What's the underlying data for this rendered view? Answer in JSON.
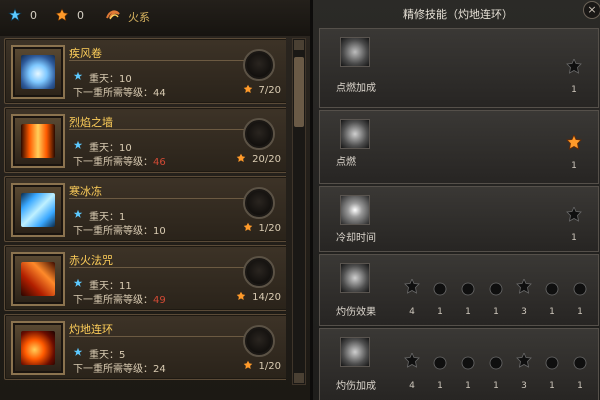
{
  "header": {
    "star_count": "0",
    "gem_count": "0",
    "fire_tab_label": "火系"
  },
  "skills": [
    {
      "name": "疾风卷",
      "level_label": "重天：10",
      "req_label": "下一重所需等级：",
      "req_value": "44",
      "req_red": false,
      "count": "7/20"
    },
    {
      "name": "烈焰之墙",
      "level_label": "重天：10",
      "req_label": "下一重所需等级：",
      "req_value": "46",
      "req_red": true,
      "count": "20/20"
    },
    {
      "name": "寒冰冻",
      "level_label": "重天：1",
      "req_label": "下一重所需等级：",
      "req_value": "10",
      "req_red": false,
      "count": "1/20"
    },
    {
      "name": "赤火法咒",
      "level_label": "重天：11",
      "req_label": "下一重所需等级：",
      "req_value": "49",
      "req_red": true,
      "count": "14/20"
    },
    {
      "name": "灼地连环",
      "level_label": "重天：5",
      "req_label": "下一重所需等级：",
      "req_value": "24",
      "req_red": false,
      "count": "1/20"
    }
  ],
  "right": {
    "title": "精修技能（灼地连环）",
    "rows": [
      {
        "label": "点燃加成",
        "values": [
          "1"
        ]
      },
      {
        "label": "点燃",
        "values": [
          "1"
        ]
      },
      {
        "label": "冷却时间",
        "values": [
          "1"
        ]
      },
      {
        "label": "灼伤效果",
        "values": [
          "4",
          "1",
          "1",
          "1",
          "3",
          "1",
          "1"
        ]
      },
      {
        "label": "灼伤加成",
        "values": [
          "4",
          "1",
          "1",
          "1",
          "3",
          "1",
          "1"
        ]
      }
    ]
  },
  "colors": {
    "accent": "#ffcf5a",
    "red": "#d24a35",
    "blue_star": "#5cc9ff",
    "orange_star": "#ff9a2a"
  }
}
